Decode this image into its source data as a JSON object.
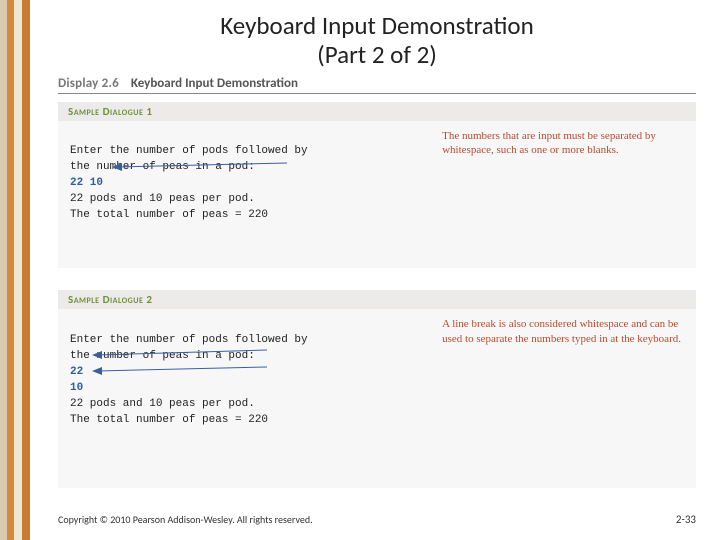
{
  "title_line1": "Keyboard Input Demonstration",
  "title_line2": "(Part 2 of 2)",
  "display": {
    "label": "Display 2.6",
    "title": "Keyboard Input Demonstration"
  },
  "samples": [
    {
      "heading": "Sample Dialogue 1",
      "lines": [
        "Enter the number of pods followed by",
        "the number of peas in a pod:",
        "22 10",
        "22 pods and 10 peas per pod.",
        "The total number of peas = 220"
      ],
      "input_line_index": 2,
      "note": "The numbers that are input must be separated by whitespace, such as one or more blanks."
    },
    {
      "heading": "Sample Dialogue 2",
      "lines": [
        "Enter the number of pods followed by",
        "the number of peas in a pod:",
        "22",
        "10",
        "22 pods and 10 peas per pod.",
        "The total number of peas = 220"
      ],
      "input_line_index": 2,
      "input_line_index2": 3,
      "note": "A line break is also considered whitespace and can be used to separate the numbers typed in at the keyboard."
    }
  ],
  "footer": "Copyright © 2010 Pearson Addison-Wesley. All rights reserved.",
  "page_number": "2-33"
}
